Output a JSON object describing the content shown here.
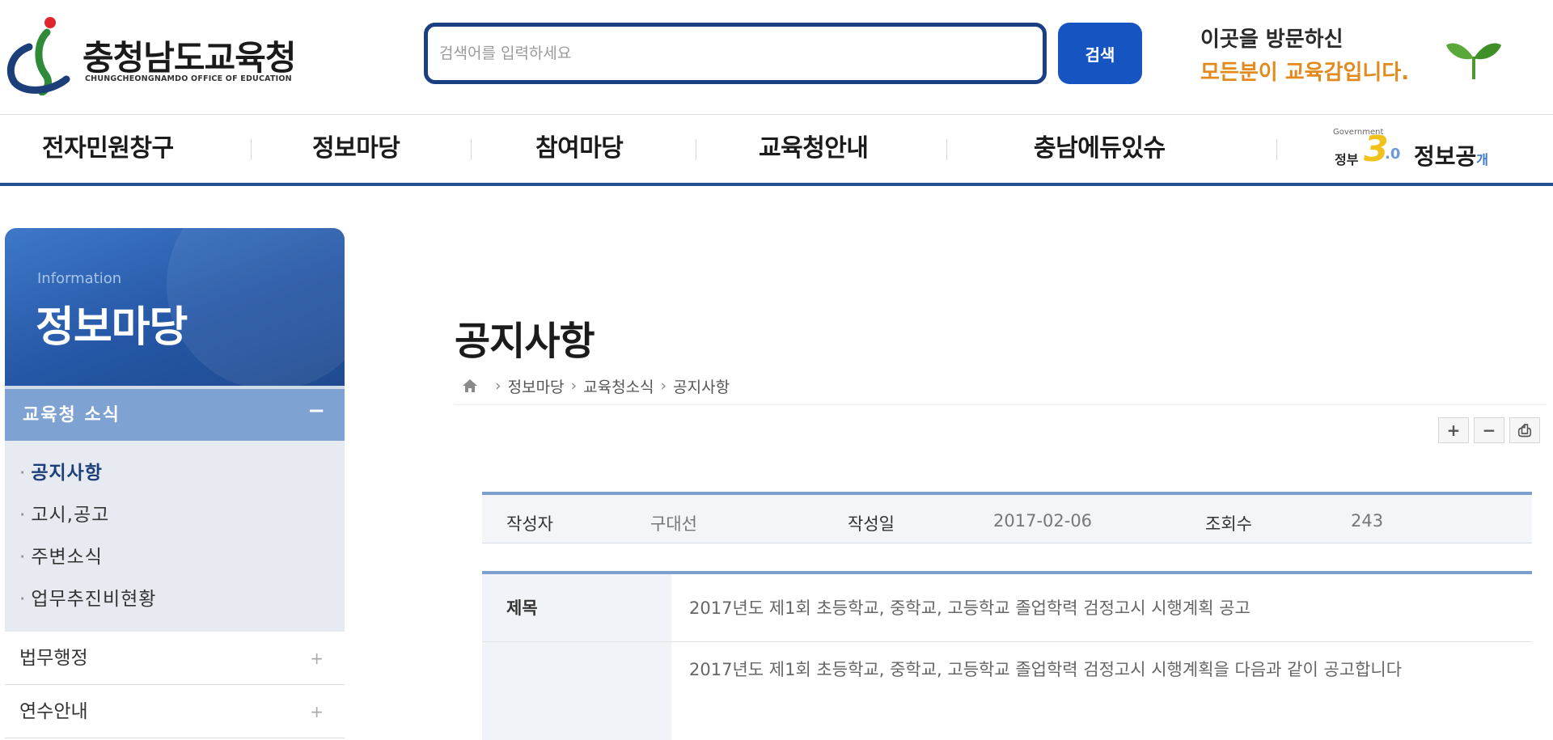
{
  "header": {
    "logo_title": "충청남도교육청",
    "logo_subtitle": "CHUNGCHEONGNAMDO OFFICE OF EDUCATION",
    "search_placeholder": "검색어를 입력하세요",
    "search_button": "검색",
    "greeting_line1": "이곳을 방문하신",
    "greeting_line2": "모든분이 교육감입니다.",
    "colors": {
      "search_border": "#1a3f82",
      "search_button": "#1654c2",
      "greeting_accent": "#e28a1e",
      "sprout": "#4a9a2e"
    }
  },
  "gnb": {
    "items": [
      "전자민원창구",
      "정보마당",
      "참여마당",
      "교육청안내",
      "충남에듀있슈"
    ],
    "special": {
      "small": "Government",
      "jeongbu": "정부",
      "three": "3",
      "zero": ".0",
      "info": "정보공",
      "gae": "개"
    },
    "border_color": "#24508f"
  },
  "sidebar": {
    "en_label": "Information",
    "title": "정보마당",
    "group_label": "교육청 소식",
    "group_toggle": "−",
    "sub_items": [
      "공지사항",
      "고시,공고",
      "주변소식",
      "업무추진비현황"
    ],
    "active_index": 0,
    "other_items": [
      {
        "label": "법무행정",
        "toggle": "+"
      },
      {
        "label": "연수안내",
        "toggle": "+"
      }
    ]
  },
  "main": {
    "page_title": "공지사항",
    "breadcrumb": [
      "정보마당",
      "교육청소식",
      "공지사항"
    ],
    "tools": [
      "+",
      "−",
      "⎙"
    ],
    "meta": {
      "author_label": "작성자",
      "author": "구대선",
      "date_label": "작성일",
      "date": "2017-02-06",
      "views_label": "조회수",
      "views": "243"
    },
    "detail": {
      "title_label": "제목",
      "title": "2017년도 제1회 초등학교, 중학교, 고등학교 졸업학력 검정고시 시행계획 공고",
      "body": "2017년도 제1회 초등학교, 중학교, 고등학교 졸업학력 검정고시 시행계획을 다음과 같이 공고합니다"
    }
  }
}
